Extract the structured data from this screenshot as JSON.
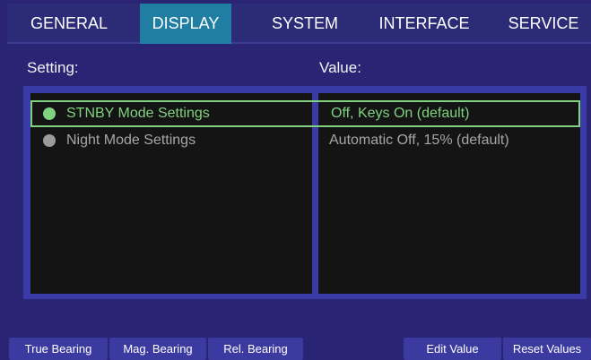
{
  "tabs": [
    {
      "label": "GENERAL"
    },
    {
      "label": "DISPLAY"
    },
    {
      "label": "SYSTEM"
    },
    {
      "label": "INTERFACE"
    },
    {
      "label": "SERVICE"
    }
  ],
  "active_tab": "DISPLAY",
  "columns": {
    "setting": "Setting:",
    "value": "Value:"
  },
  "rows": [
    {
      "setting": "STNBY Mode Settings",
      "value": "Off, Keys On (default)",
      "selected": true
    },
    {
      "setting": "Night Mode Settings",
      "value": "Automatic Off, 15% (default)",
      "selected": false
    }
  ],
  "buttons": [
    {
      "label": "True Bearing"
    },
    {
      "label": "Mag. Bearing"
    },
    {
      "label": "Rel. Bearing"
    },
    {
      "label": "Edit Value"
    },
    {
      "label": "Reset Values"
    }
  ],
  "colors": {
    "background": "#2a2474",
    "active_tab": "#1f7ea2",
    "selected_text": "#7fd37f",
    "unselected_text": "#a6a6a6",
    "button": "#3b3aa0"
  }
}
